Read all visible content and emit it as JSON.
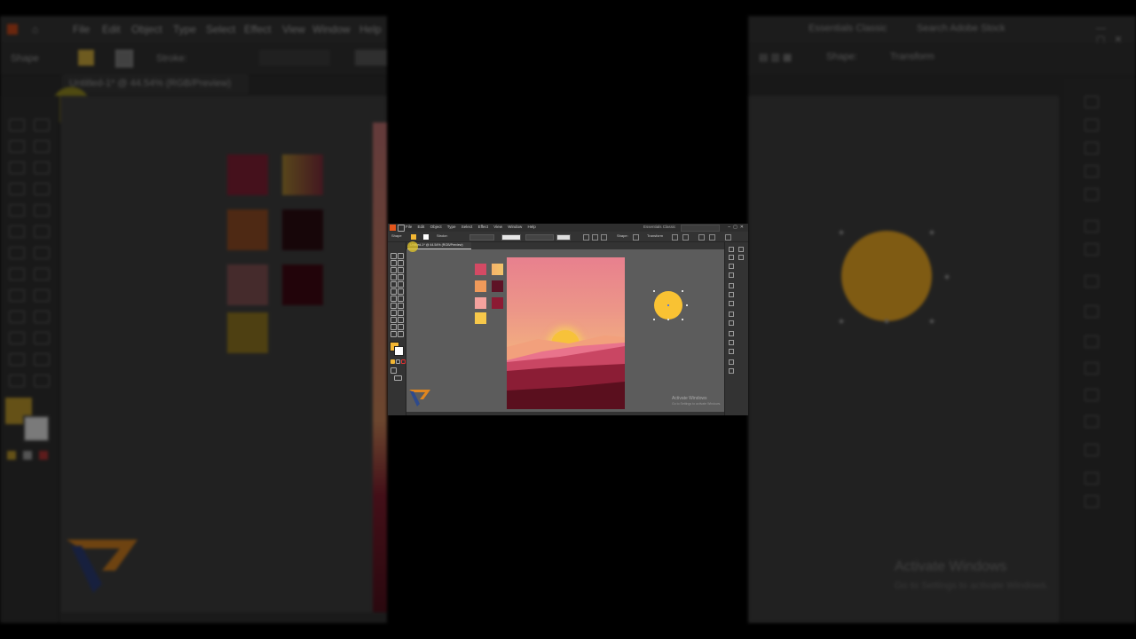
{
  "app": {
    "menus": [
      "File",
      "Edit",
      "Object",
      "Type",
      "Select",
      "Effect",
      "View",
      "Window",
      "Help"
    ],
    "workspace": "Essentials Classic",
    "search_placeholder": "Search Adobe Stock",
    "document_tab": "Untitled-1* @ 44.54% (RGB/Preview)"
  },
  "control_bar": {
    "mode_label": "Shape",
    "stroke_label": "Stroke:",
    "shape_label": "Shape:",
    "transform_label": "Transform"
  },
  "swatches": [
    "#d44a64",
    "#f5b36a",
    "#f09a5a",
    "#5e1226",
    "#f4a29e",
    "#8c1a33",
    "#f7c84a"
  ],
  "artboard_colors": {
    "sky_top": "#e8808e",
    "sky_bottom": "#f6bd7c",
    "sun": "#f7c23a",
    "hill_light": "#f2a07c",
    "hill_pink": "#e9738c",
    "hill_mid": "#c94663",
    "ground": "#8b1d35",
    "ground_dark": "#5a0f1e"
  },
  "sun_object": {
    "color": "#f9c233"
  },
  "watermark": {
    "title": "Activate Windows",
    "subtitle": "Go to Settings to activate Windows."
  },
  "icons": [
    "ai-logo-icon",
    "home-icon",
    "selection-tool-icon",
    "direct-selection-tool-icon",
    "pen-tool-icon",
    "type-tool-icon",
    "rectangle-tool-icon",
    "zoom-tool-icon",
    "fill-swatch-icon",
    "stroke-swatch-icon"
  ]
}
